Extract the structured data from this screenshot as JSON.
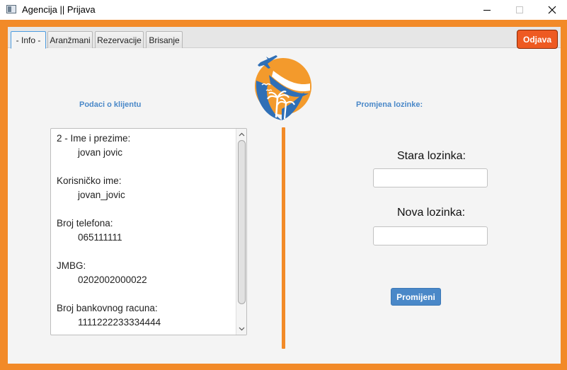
{
  "window": {
    "title": "Agencija || Prijava"
  },
  "tabs": [
    {
      "label": "- Info -",
      "active": true
    },
    {
      "label": "Aranžmani",
      "active": false
    },
    {
      "label": "Rezervacije",
      "active": false
    },
    {
      "label": "Brisanje",
      "active": false
    }
  ],
  "header": {
    "logout_label": "Odjava"
  },
  "client": {
    "section_title": "Podaci o klijentu",
    "items": [
      {
        "label": "2 - Ime i prezime:",
        "value": "jovan jovic"
      },
      {
        "label": "Korisničko ime:",
        "value": "jovan_jovic"
      },
      {
        "label": "Broj telefona:",
        "value": "065111111"
      },
      {
        "label": "JMBG:",
        "value": "0202002000022"
      },
      {
        "label": "Broj bankovnog racuna:",
        "value": "1111222233334444"
      }
    ]
  },
  "password": {
    "section_title": "Promjena lozinke:",
    "old_label": "Stara lozinka:",
    "old_value": "",
    "new_label": "Nova lozinka:",
    "new_value": "",
    "submit_label": "Promijeni"
  },
  "colors": {
    "frame": "#f28a28",
    "accent_blue": "#4a88c8",
    "logout": "#ee5a22"
  },
  "icons": {
    "logo": "travel-agency-logo",
    "close": "close-icon",
    "minimize": "minimize-icon",
    "maximize": "maximize-icon"
  }
}
